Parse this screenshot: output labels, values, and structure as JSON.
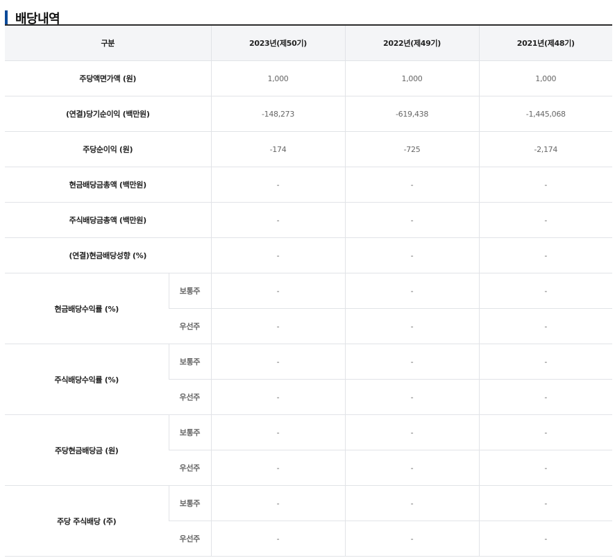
{
  "section": {
    "title": "배당내역"
  },
  "table": {
    "header": {
      "category": "구분",
      "years": [
        "2023년(제50기)",
        "2022년(제49기)",
        "2021년(제48기)"
      ]
    },
    "rows": [
      {
        "label": "주당액면가액 (원)",
        "values": [
          "1,000",
          "1,000",
          "1,000"
        ]
      },
      {
        "label": "(연결)당기순이익 (백만원)",
        "values": [
          "-148,273",
          "-619,438",
          "-1,445,068"
        ]
      },
      {
        "label": "주당순이익 (원)",
        "values": [
          "-174",
          "-725",
          "-2,174"
        ]
      },
      {
        "label": "현금배당금총액 (백만원)",
        "values": [
          "-",
          "-",
          "-"
        ]
      },
      {
        "label": "주식배당금총액 (백만원)",
        "values": [
          "-",
          "-",
          "-"
        ]
      },
      {
        "label": "(연결)현금배당성향 (%)",
        "values": [
          "-",
          "-",
          "-"
        ]
      }
    ],
    "grouped_rows": [
      {
        "label": "현금배당수익률 (%)",
        "subs": [
          {
            "label": "보통주",
            "values": [
              "-",
              "-",
              "-"
            ]
          },
          {
            "label": "우선주",
            "values": [
              "-",
              "-",
              "-"
            ]
          }
        ]
      },
      {
        "label": "주식배당수익률 (%)",
        "subs": [
          {
            "label": "보통주",
            "values": [
              "-",
              "-",
              "-"
            ]
          },
          {
            "label": "우선주",
            "values": [
              "-",
              "-",
              "-"
            ]
          }
        ]
      },
      {
        "label": "주당현금배당금 (원)",
        "subs": [
          {
            "label": "보통주",
            "values": [
              "-",
              "-",
              "-"
            ]
          },
          {
            "label": "우선주",
            "values": [
              "-",
              "-",
              "-"
            ]
          }
        ]
      },
      {
        "label": "주당 주식배당 (주)",
        "subs": [
          {
            "label": "보통주",
            "values": [
              "-",
              "-",
              "-"
            ]
          },
          {
            "label": "우선주",
            "values": [
              "-",
              "-",
              "-"
            ]
          }
        ]
      }
    ]
  },
  "colors": {
    "accent": "#0b4a9a",
    "header_bg": "#f4f5f7",
    "border": "#e1e3e7"
  }
}
